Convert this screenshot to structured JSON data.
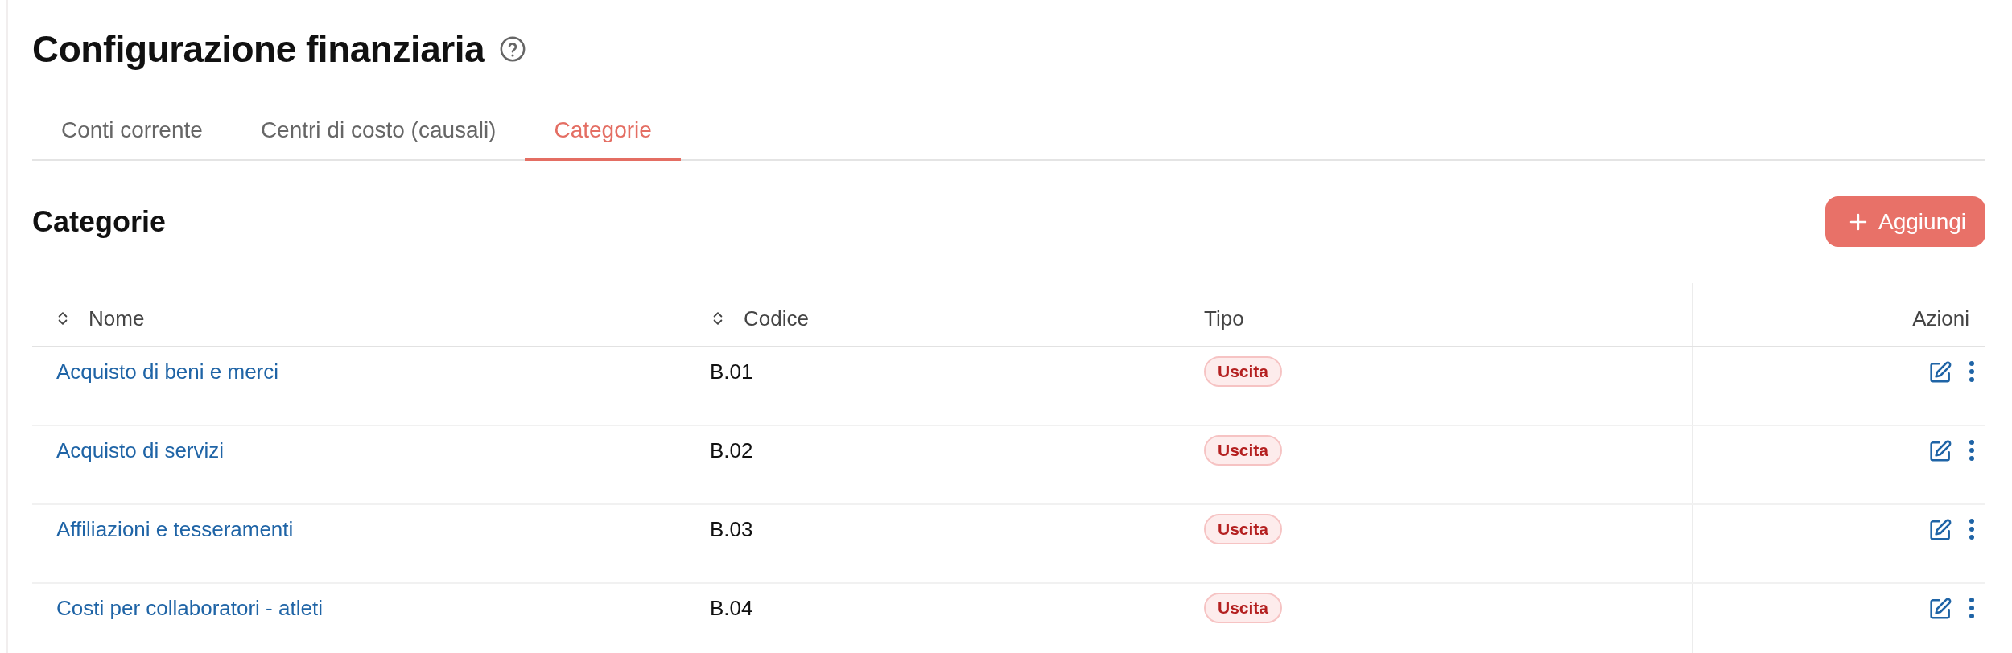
{
  "page": {
    "title": "Configurazione finanziaria"
  },
  "tabs": [
    {
      "label": "Conti corrente",
      "selected": false
    },
    {
      "label": "Centri di costo (causali)",
      "selected": false
    },
    {
      "label": "Categorie",
      "selected": true
    }
  ],
  "section": {
    "title": "Categorie",
    "add_button": "Aggiungi"
  },
  "table": {
    "columns": [
      {
        "label": "Nome",
        "sortable": true
      },
      {
        "label": "Codice",
        "sortable": true
      },
      {
        "label": "Tipo",
        "sortable": false
      },
      {
        "label": "Azioni",
        "sortable": false
      }
    ],
    "rows": [
      {
        "nome": "Acquisto di beni e merci",
        "codice": "B.01",
        "tipo": "Uscita"
      },
      {
        "nome": "Acquisto di servizi",
        "codice": "B.02",
        "tipo": "Uscita"
      },
      {
        "nome": "Affiliazioni e tesseramenti",
        "codice": "B.03",
        "tipo": "Uscita"
      },
      {
        "nome": "Costi per collaboratori - atleti",
        "codice": "B.04",
        "tipo": "Uscita"
      }
    ]
  }
}
